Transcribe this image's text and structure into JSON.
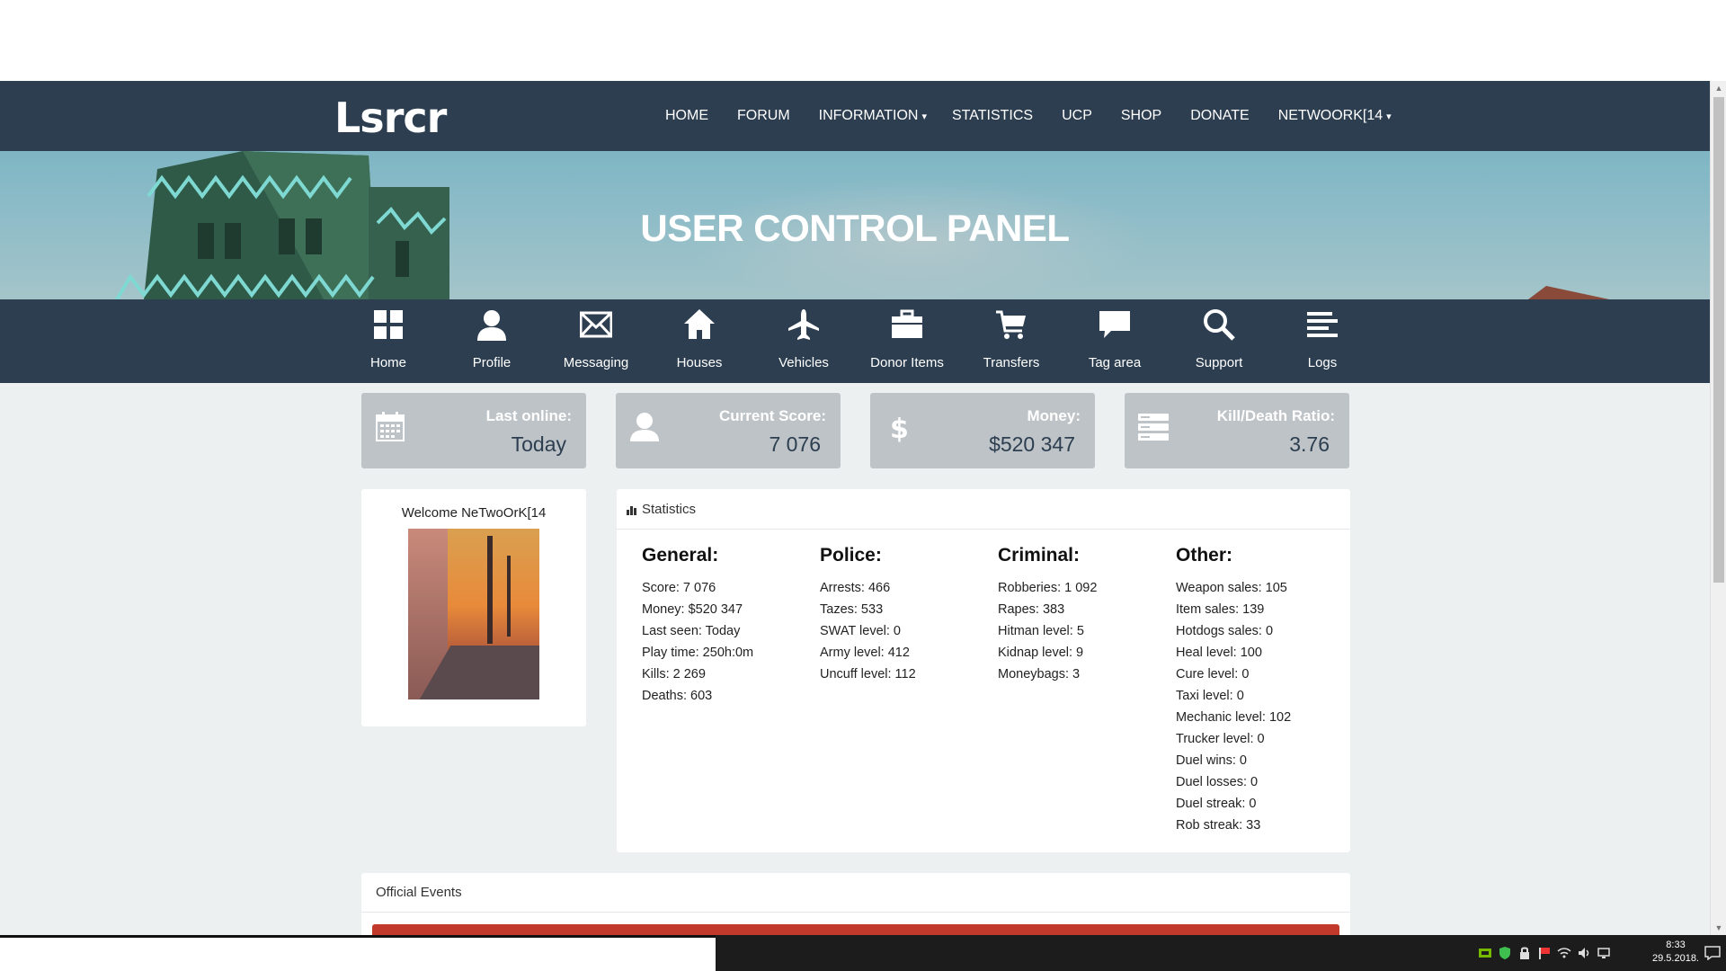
{
  "header": {
    "logo": "Lsrcr",
    "nav": [
      {
        "label": "HOME",
        "caret": ""
      },
      {
        "label": "FORUM",
        "caret": ""
      },
      {
        "label": "INFORMATION",
        "caret": "▾"
      },
      {
        "label": "STATISTICS",
        "caret": ""
      },
      {
        "label": "UCP",
        "caret": ""
      },
      {
        "label": "SHOP",
        "caret": ""
      },
      {
        "label": "DONATE",
        "caret": ""
      },
      {
        "label": "NETWOORK[14",
        "caret": "▾"
      }
    ]
  },
  "hero": {
    "title": "USER CONTROL PANEL"
  },
  "iconbar": [
    {
      "label": "Home",
      "icon": "grid-icon"
    },
    {
      "label": "Profile",
      "icon": "user-icon"
    },
    {
      "label": "Messaging",
      "icon": "envelope-icon"
    },
    {
      "label": "Houses",
      "icon": "house-icon"
    },
    {
      "label": "Vehicles",
      "icon": "plane-icon"
    },
    {
      "label": "Donor Items",
      "icon": "briefcase-icon"
    },
    {
      "label": "Transfers",
      "icon": "cart-icon"
    },
    {
      "label": "Tag area",
      "icon": "chat-icon"
    },
    {
      "label": "Support",
      "icon": "search-icon"
    },
    {
      "label": "Logs",
      "icon": "list-icon"
    }
  ],
  "cards": [
    {
      "label": "Last online:",
      "value": "Today",
      "icon": "calendar-icon"
    },
    {
      "label": "Current Score:",
      "value": "7 076",
      "icon": "user-icon"
    },
    {
      "label": "Money:",
      "value": "$520 347",
      "icon": "dollar-icon"
    },
    {
      "label": "Kill/Death Ratio:",
      "value": "3.76",
      "icon": "server-icon"
    }
  ],
  "welcome": {
    "text": "Welcome NeTwoOrK[14"
  },
  "statistics": {
    "title": "Statistics",
    "columns": [
      {
        "heading": "General:",
        "items": [
          "Score: 7 076",
          "Money: $520 347",
          "Last seen: Today",
          "Play time: 250h:0m",
          "Kills: 2 269",
          "Deaths: 603"
        ]
      },
      {
        "heading": "Police:",
        "items": [
          "Arrests: 466",
          "Tazes: 533",
          "SWAT level: 0",
          "Army level: 412",
          "Uncuff level: 112"
        ]
      },
      {
        "heading": "Criminal:",
        "items": [
          "Robberies: 1 092",
          "Rapes: 383",
          "Hitman level: 5",
          "Kidnap level: 9",
          "Moneybags: 3"
        ]
      },
      {
        "heading": "Other:",
        "items": [
          "Weapon sales: 105",
          "Item sales: 139",
          "Hotdogs sales: 0",
          "Heal level: 100",
          "Cure level: 0",
          "Taxi level: 0",
          "Mechanic level: 102",
          "Trucker level: 0",
          "Duel wins: 0",
          "Duel losses: 0",
          "Duel streak: 0",
          "Rob streak: 33"
        ]
      }
    ]
  },
  "events": {
    "title": "Official Events"
  },
  "taskbar": {
    "time": "8:33",
    "date": "29.5.2018."
  },
  "colors": {
    "navbar": "#2c3e50",
    "card": "#bdc3c7",
    "background": "#ecf0f1",
    "event_bar": "#c0392b"
  }
}
